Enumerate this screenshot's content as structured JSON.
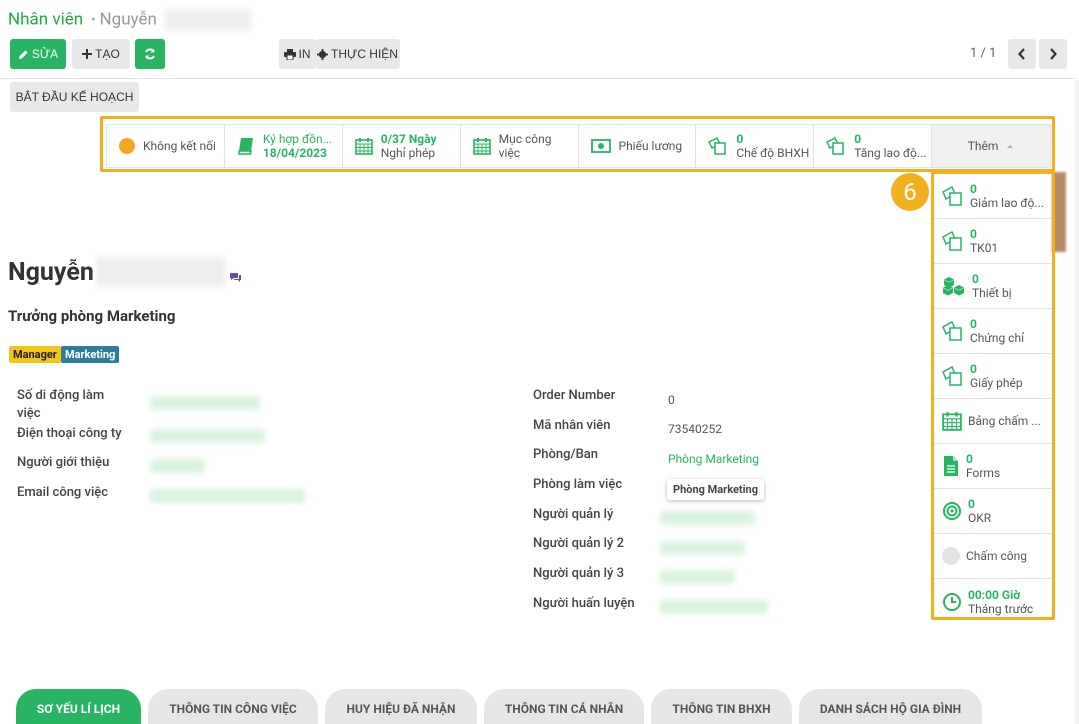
{
  "breadcrumb": {
    "parent": "Nhân viên",
    "separator": "•",
    "current": "Nguyễn"
  },
  "toolbar": {
    "edit": "SỬA",
    "create": "TẠO",
    "print": "IN",
    "action": "THỰC HIỆN"
  },
  "pager": {
    "text": "1 / 1"
  },
  "plan_button": "BẮT ĐẦU KẾ HOẠCH",
  "statusbar": {
    "connect": "Không kết nối",
    "contract_title": "Ký hợp đồn...",
    "contract_date": "18/04/2023",
    "leave_value": "0/37 Ngày",
    "leave_label": "Nghỉ phép",
    "work_label_1": "Mục công",
    "work_label_2": "việc",
    "payslip": "Phiếu lương",
    "bhxh_value": "0",
    "bhxh_label": "Chế độ BHXH",
    "increase_value": "0",
    "increase_label": "Tăng lao độ...",
    "more": "Thêm"
  },
  "callout_number": "6",
  "dropdown": [
    {
      "value": "0",
      "label": "Giảm lao độ...",
      "icon": "copy-icon"
    },
    {
      "value": "0",
      "label": "TK01",
      "icon": "copy-icon"
    },
    {
      "value": "0",
      "label": "Thiết bị",
      "icon": "cubes-icon"
    },
    {
      "value": "0",
      "label": "Chứng chỉ",
      "icon": "copy-icon"
    },
    {
      "value": "0",
      "label": "Giấy phép",
      "icon": "copy-icon"
    },
    {
      "value": "",
      "label": "Bảng chấm ...",
      "icon": "calendar-icon"
    },
    {
      "value": "0",
      "label": "Forms",
      "icon": "file-icon"
    },
    {
      "value": "0",
      "label": "OKR",
      "icon": "target-icon"
    },
    {
      "value": "",
      "label": "Chấm công",
      "icon": "circle-icon"
    },
    {
      "value": "00:00 Giờ",
      "label": "Tháng trước",
      "icon": "clock-icon"
    }
  ],
  "employee": {
    "name": "Nguyễn",
    "job_title": "Trưởng phòng Marketing",
    "tags": [
      "Manager",
      "Marketing"
    ]
  },
  "left_fields": {
    "mobile_1": "Số di động làm",
    "mobile_2": "việc",
    "work_phone": "Điện thoại công ty",
    "referrer": "Người giới thiệu",
    "work_email": "Email công việc"
  },
  "right_fields": {
    "order_label": "Order Number",
    "order_value": "0",
    "code_label": "Mã nhân viên",
    "code_value": "73540252",
    "dept_label": "Phòng/Ban",
    "dept_value": "Phòng Marketing",
    "workplace_label": "Phòng làm việc",
    "manager_label": "Người quản lý",
    "manager2_label": "Người quản lý 2",
    "manager3_label": "Người quản lý 3",
    "coach_label": "Người huấn luyện"
  },
  "tooltip": "Phòng Marketing",
  "tabs": [
    "SƠ YẾU LÍ LỊCH",
    "THÔNG TIN CÔNG VIỆC",
    "HUY HIỆU ĐÃ NHẬN",
    "THÔNG TIN CÁ NHÂN",
    "THÔNG TIN BHXH",
    "DANH SÁCH HỘ GIA ĐÌNH"
  ],
  "colors": {
    "accent": "#28b463",
    "highlight": "#f2b01e",
    "tag_manager": "#f2c318",
    "tag_marketing": "#2e7d9a"
  }
}
